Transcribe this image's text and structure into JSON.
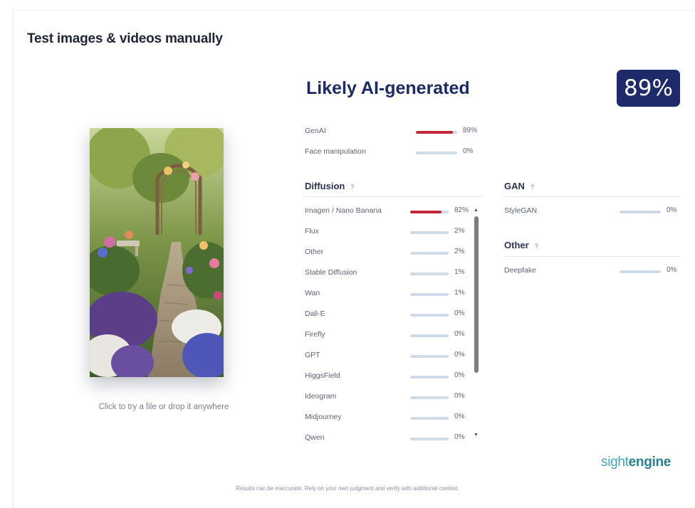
{
  "page_title": "Test images & videos manually",
  "upload": {
    "hint": "Click to try a file or drop it anywhere",
    "image_alt": "garden path with flowers"
  },
  "verdict": {
    "label": "Likely AI-generated",
    "score": "89%"
  },
  "summary": [
    {
      "name": "GenAI",
      "value": 89,
      "pct": "89%"
    },
    {
      "name": "Face manipulation",
      "value": 0,
      "pct": "0%"
    }
  ],
  "diffusion": {
    "title": "Diffusion",
    "help": "?",
    "items": [
      {
        "name": "Imagen / Nano Banana",
        "value": 82,
        "pct": "82%"
      },
      {
        "name": "Flux",
        "value": 2,
        "pct": "2%"
      },
      {
        "name": "Other",
        "value": 2,
        "pct": "2%"
      },
      {
        "name": "Stable Diffusion",
        "value": 1,
        "pct": "1%"
      },
      {
        "name": "Wan",
        "value": 1,
        "pct": "1%"
      },
      {
        "name": "Dall-E",
        "value": 0,
        "pct": "0%"
      },
      {
        "name": "Firefly",
        "value": 0,
        "pct": "0%"
      },
      {
        "name": "GPT",
        "value": 0,
        "pct": "0%"
      },
      {
        "name": "HiggsField",
        "value": 0,
        "pct": "0%"
      },
      {
        "name": "Ideogram",
        "value": 0,
        "pct": "0%"
      },
      {
        "name": "Midjourney",
        "value": 0,
        "pct": "0%"
      },
      {
        "name": "Qwen",
        "value": 0,
        "pct": "0%"
      }
    ]
  },
  "gan": {
    "title": "GAN",
    "help": "?",
    "items": [
      {
        "name": "StyleGAN",
        "value": 0,
        "pct": "0%"
      }
    ]
  },
  "other": {
    "title": "Other",
    "help": "?",
    "items": [
      {
        "name": "Deepfake",
        "value": 0,
        "pct": "0%"
      }
    ]
  },
  "colors": {
    "accent": "#1f2a6b",
    "bar_fill": "#c4263a",
    "bar_track": "#cfdbe8",
    "brand": "#3da8b8"
  },
  "brand": {
    "part1": "sight",
    "part2": "engine"
  },
  "disclaimer": "Results can be inaccurate. Rely on your own judgment and verify with additional context.",
  "icons": {
    "scroll_up": "▲",
    "scroll_down": "▼"
  }
}
